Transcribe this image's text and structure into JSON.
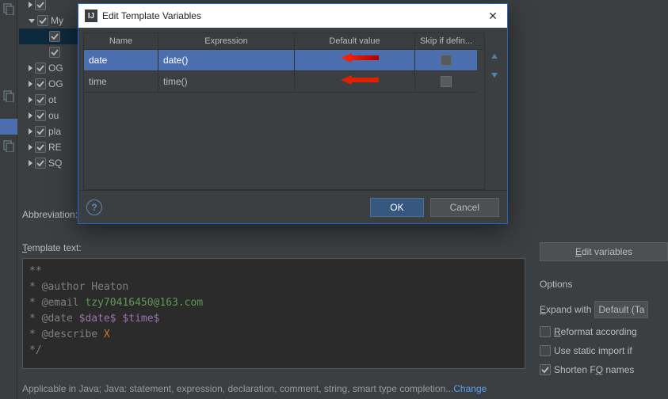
{
  "tree": {
    "items": [
      {
        "label": "",
        "arrow": "right",
        "checked": true
      },
      {
        "label": "My",
        "arrow": "down",
        "checked": true
      },
      {
        "label": "",
        "arrow": "none",
        "checked": true,
        "indented": true,
        "selected": true
      },
      {
        "label": "",
        "arrow": "none",
        "checked": true,
        "indented": true
      },
      {
        "label": "OG",
        "arrow": "right",
        "checked": true
      },
      {
        "label": "OG",
        "arrow": "right",
        "checked": true
      },
      {
        "label": "ot",
        "arrow": "right",
        "checked": true
      },
      {
        "label": "ou",
        "arrow": "right",
        "checked": true
      },
      {
        "label": "pla",
        "arrow": "right",
        "checked": true
      },
      {
        "label": "RE",
        "arrow": "right",
        "checked": true
      },
      {
        "label": "SQ",
        "arrow": "right",
        "checked": true
      }
    ]
  },
  "abbr_label": "Abbreviation:",
  "template_label": "Template text:",
  "template_lines": [
    {
      "t": "**",
      "c": "gray"
    },
    {
      "t": "* @author Heaton",
      "c": "gray"
    },
    {
      "prefix": "* @email ",
      "green": "tzy70416450@163.com",
      "pc": "gray"
    },
    {
      "prefix": "* @date ",
      "purple": "$date$ $time$",
      "pc": "gray"
    },
    {
      "prefix": "* @describe ",
      "orange": "X",
      "pc": "gray"
    },
    {
      "t": "*/",
      "c": "gray"
    }
  ],
  "bottom": {
    "text": "Applicable in Java; Java: statement, expression, declaration, comment, string, smart type completion...",
    "link": "Change"
  },
  "rightPanel": {
    "edit_vars": "Edit variables",
    "options": "Options",
    "expand_label": "Expand with",
    "expand_value": "Default (Ta",
    "reformat": "Reformat according",
    "static_import": "Use static import if",
    "shorten": "Shorten FQ names"
  },
  "dialog": {
    "title": "Edit Template Variables",
    "columns": {
      "name": "Name",
      "expr": "Expression",
      "def": "Default value",
      "skip": "Skip if defin..."
    },
    "rows": [
      {
        "name": "date",
        "expr": "date()",
        "def": "",
        "selected": true
      },
      {
        "name": "time",
        "expr": "time()",
        "def": "",
        "selected": false
      }
    ],
    "ok": "OK",
    "cancel": "Cancel"
  }
}
